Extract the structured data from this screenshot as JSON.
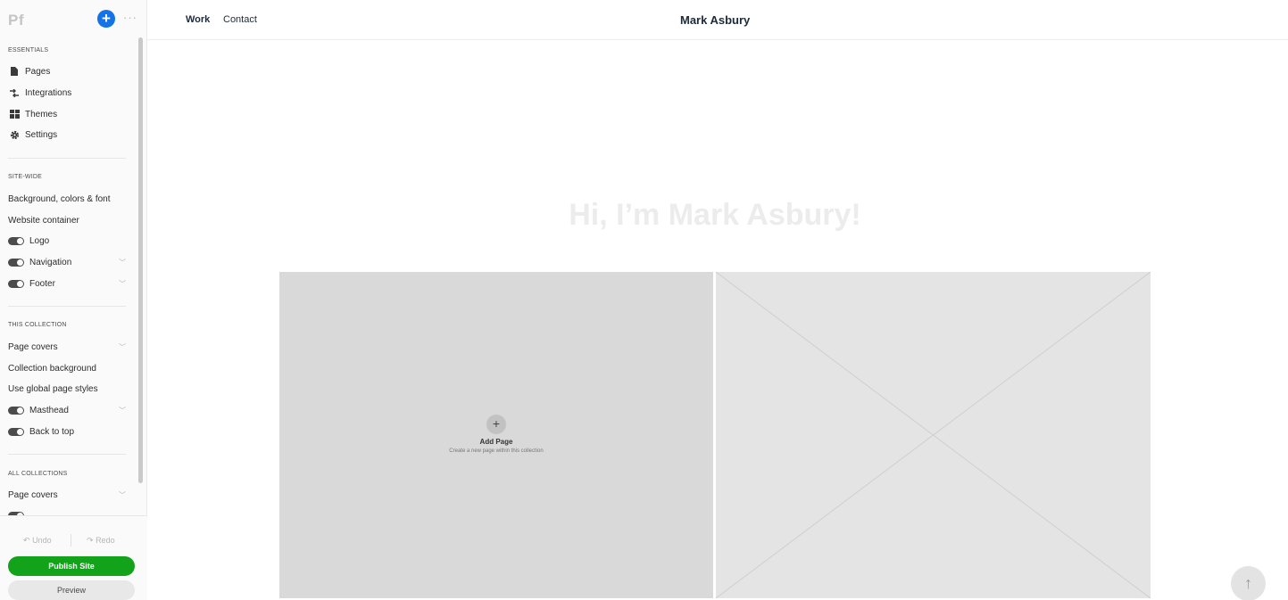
{
  "sidebar": {
    "logo": "Pf",
    "add_icon": "plus-icon",
    "more_icon": "ellipsis-icon",
    "essentials": {
      "title": "ESSENTIALS",
      "items": [
        {
          "label": "Pages",
          "icon": "page-icon"
        },
        {
          "label": "Integrations",
          "icon": "integrations-icon"
        },
        {
          "label": "Themes",
          "icon": "themes-icon"
        },
        {
          "label": "Settings",
          "icon": "gear-icon"
        }
      ]
    },
    "site_wide": {
      "title": "SITE-WIDE",
      "items": [
        {
          "label": "Background, colors & font"
        },
        {
          "label": "Website container"
        },
        {
          "label": "Logo",
          "toggle": true
        },
        {
          "label": "Navigation",
          "toggle": true,
          "chevron": true
        },
        {
          "label": "Footer",
          "toggle": true,
          "chevron": true
        }
      ]
    },
    "this_collection": {
      "title": "THIS COLLECTION",
      "items": [
        {
          "label": "Page covers",
          "chevron": true
        },
        {
          "label": "Collection background"
        },
        {
          "label": "Use global page styles"
        },
        {
          "label": "Masthead",
          "toggle": true,
          "chevron": true
        },
        {
          "label": "Back to top",
          "toggle": true
        }
      ]
    },
    "all_collections": {
      "title": "ALL COLLECTIONS",
      "items": [
        {
          "label": "Page covers",
          "chevron": true
        }
      ]
    },
    "undo_label": "Undo",
    "redo_label": "Redo",
    "publish_label": "Publish Site",
    "preview_label": "Preview"
  },
  "header": {
    "nav": [
      "Work",
      "Contact"
    ],
    "title": "Mark Asbury"
  },
  "main": {
    "hero": "Hi, I’m Mark Asbury!",
    "add_page_title": "Add Page",
    "add_page_sub": "Create a new page within this collection"
  },
  "colors": {
    "accent": "#1473e6",
    "publish": "#12a31b"
  }
}
